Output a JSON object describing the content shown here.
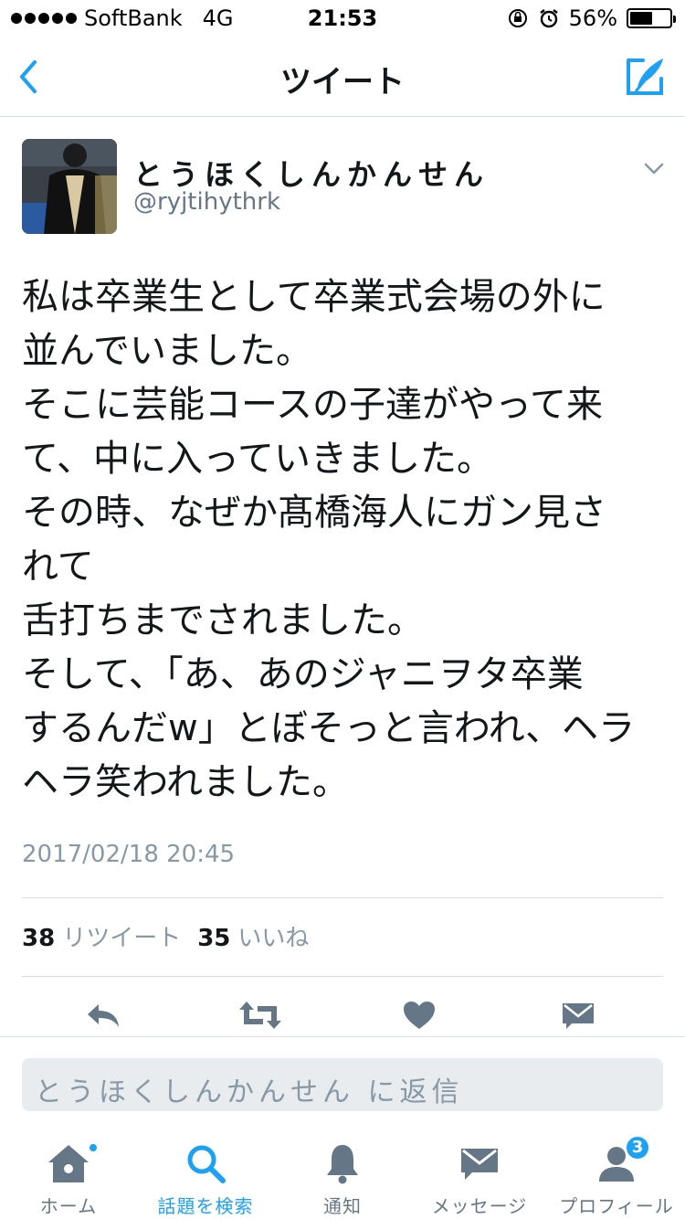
{
  "status_bar": {
    "carrier": "SoftBank",
    "network": "4G",
    "time": "21:53",
    "battery_percent_label": "56%",
    "battery_level": 0.56
  },
  "nav": {
    "title": "ツイート",
    "back_icon": "chevron-left-icon",
    "compose_icon": "compose-tweet-icon"
  },
  "tweet": {
    "display_name": "とうほくしんかんせん",
    "handle": "@ryjtihythrk",
    "text_lines": [
      "私は卒業生として卒業式会場の外に",
      "並んでいました。",
      "そこに芸能コースの子達がやって来",
      "て、中に入っていきました。",
      "その時、なぜか髙橋海人にガン見さ",
      "れて",
      "舌打ちまでされました。",
      "そして、「あ、あのジャニヲタ卒業",
      "するんだw」とぼそっと言われ、ヘラ",
      "ヘラ笑われました。"
    ],
    "timestamp": "2017/02/18 20:45",
    "retweet_count": "38",
    "retweet_label": "リツイート",
    "like_count": "35",
    "like_label": "いいね"
  },
  "reply": {
    "placeholder": "とうほくしんかんせん に返信"
  },
  "tabs": [
    {
      "label": "ホーム",
      "icon": "home-icon"
    },
    {
      "label": "話題を検索",
      "icon": "search-icon"
    },
    {
      "label": "通知",
      "icon": "bell-icon"
    },
    {
      "label": "メッセージ",
      "icon": "envelope-icon"
    },
    {
      "label": "プロフィール",
      "icon": "profile-icon",
      "badge": "3"
    }
  ],
  "colors": {
    "accent": "#1da1f2",
    "icon_gray": "#657786",
    "muted_text": "#8899a6"
  }
}
